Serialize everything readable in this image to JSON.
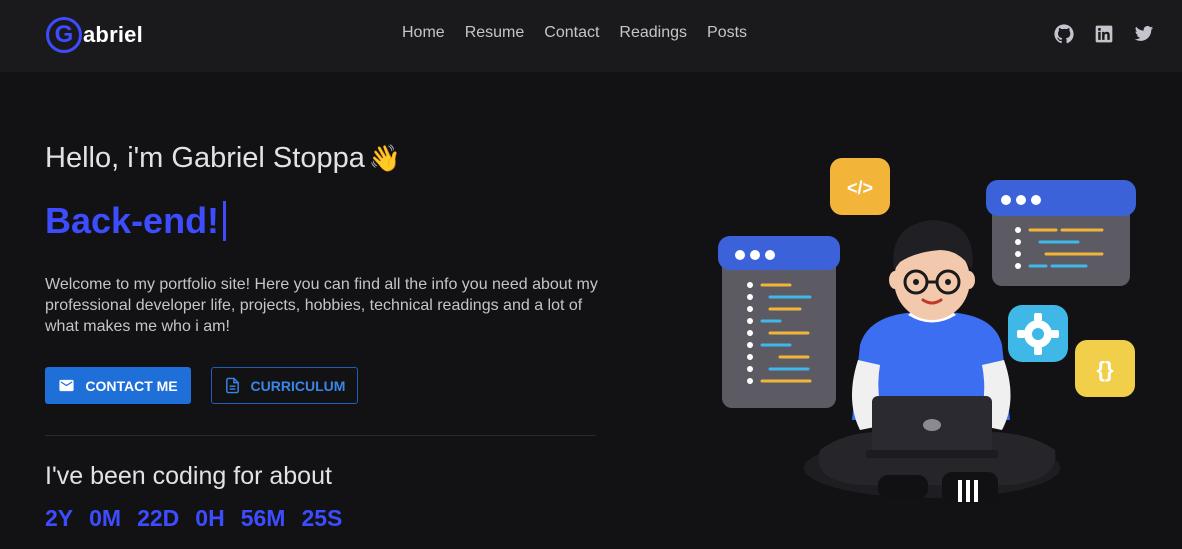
{
  "header": {
    "logo_letter": "G",
    "logo_text": "abriel",
    "nav": [
      "Home",
      "Resume",
      "Contact",
      "Readings",
      "Posts"
    ],
    "socials": [
      "github-icon",
      "linkedin-icon",
      "twitter-icon"
    ]
  },
  "hero": {
    "greeting": "Hello, i'm Gabriel Stoppa",
    "wave_emoji": "👋",
    "role": "Back-end!",
    "intro": "Welcome to my portfolio site! Here you can find all the info you need about my professional developer life, projects, hobbies, technical readings and a lot of what makes me who i am!",
    "contact_button": "CONTACT ME",
    "curriculum_button": "CURRICULUM",
    "coding_label": "I've been coding for about",
    "counter": [
      "2Y",
      "0M",
      "22D",
      "0H",
      "56M",
      "25S"
    ]
  },
  "illustration": {
    "code_badge": "</>",
    "braces_badge": "{}"
  },
  "colors": {
    "accent": "#3d4cff",
    "button_primary": "#1f6fd9",
    "background": "#121214",
    "header": "#1a1a1c"
  }
}
